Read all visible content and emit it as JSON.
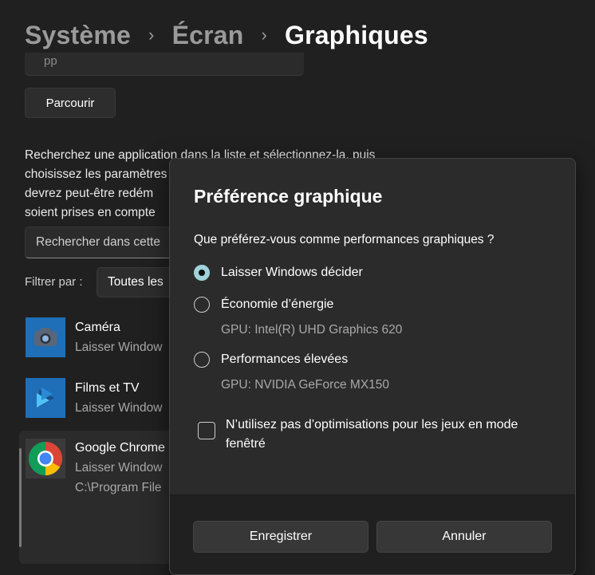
{
  "breadcrumb": {
    "items": [
      "Système",
      "Écran"
    ],
    "separator": "›",
    "current": "Graphiques"
  },
  "partial_field_text": "pp",
  "browse_button": "Parcourir",
  "description_lines": [
    "Recherchez une application dans la liste et sélectionnez-la, puis",
    "choisissez les paramètres",
    "devrez peut-être redém",
    "soient prises en compte"
  ],
  "search": {
    "placeholder": "Rechercher dans cette"
  },
  "filter": {
    "label": "Filtrer par :",
    "value": "Toutes les"
  },
  "apps": [
    {
      "name": "Caméra",
      "sub": "Laisser Window",
      "icon": "camera-icon"
    },
    {
      "name": "Films et TV",
      "sub": "Laisser Window",
      "icon": "films-tv-icon"
    },
    {
      "name": "Google Chrome",
      "sub": "Laisser Window",
      "path": "C:\\Program File",
      "icon": "chrome-icon",
      "selected": true
    }
  ],
  "dialog": {
    "title": "Préférence graphique",
    "question": "Que préférez-vous comme performances graphiques ?",
    "options": [
      {
        "label": "Laisser Windows décider",
        "sub": "",
        "selected": true
      },
      {
        "label": "Économie d’énergie",
        "sub": "GPU: Intel(R) UHD Graphics 620",
        "selected": false
      },
      {
        "label": "Performances élevées",
        "sub": "GPU: NVIDIA GeForce MX150",
        "selected": false
      }
    ],
    "checkbox": {
      "label": "N’utilisez pas d’optimisations pour les jeux en mode fenêtré",
      "checked": false
    },
    "save_button": "Enregistrer",
    "cancel_button": "Annuler"
  },
  "colors": {
    "background": "#202020",
    "dialog": "#2b2b2b",
    "accent": "#9fd3d9"
  }
}
